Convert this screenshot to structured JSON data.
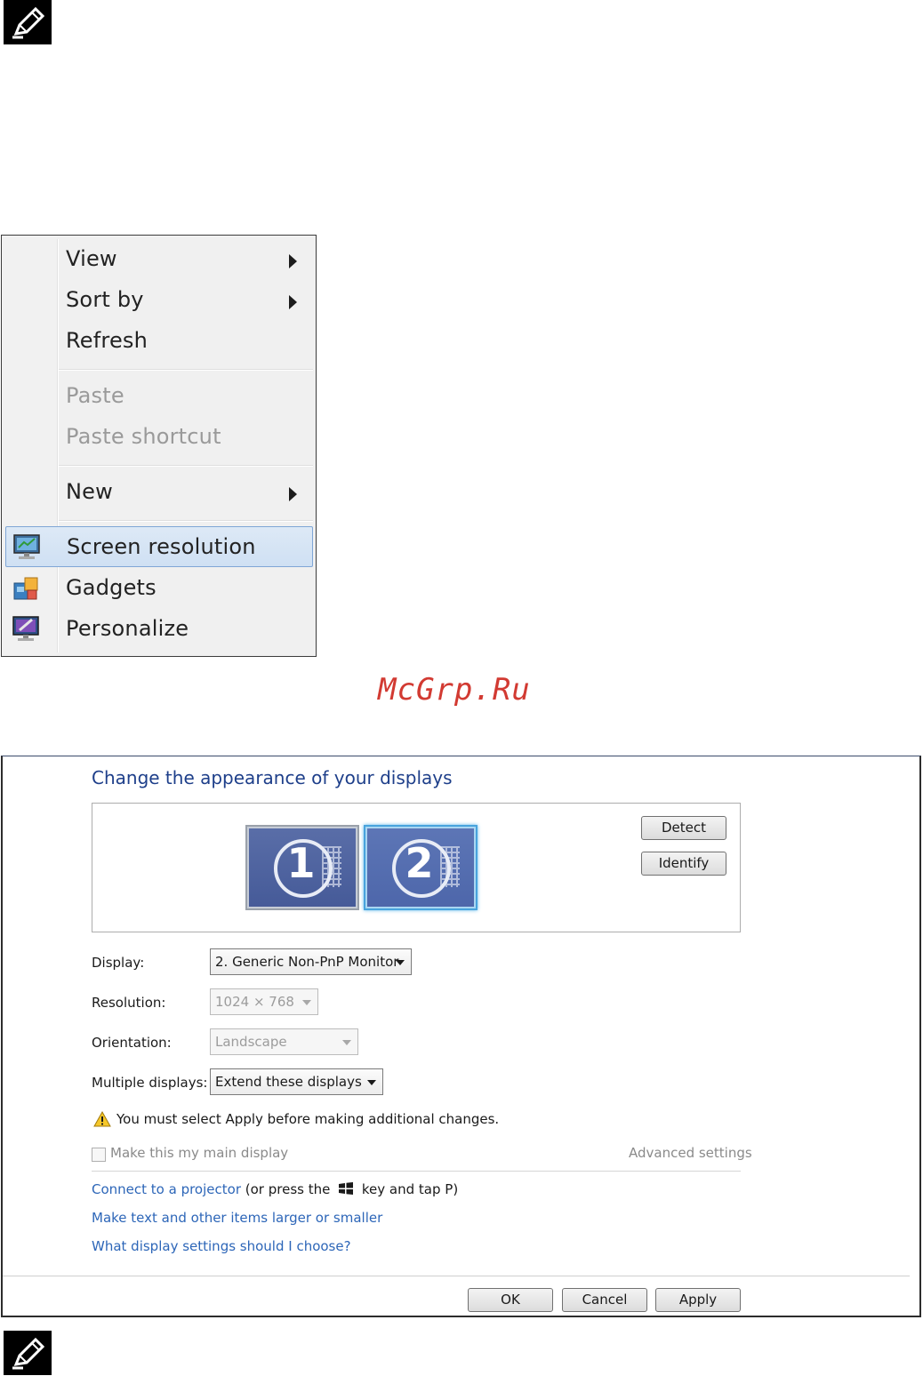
{
  "context_menu": {
    "items": [
      {
        "label": "View"
      },
      {
        "label": "Sort by"
      },
      {
        "label": "Refresh"
      },
      {
        "label": "Paste"
      },
      {
        "label": "Paste shortcut"
      },
      {
        "label": "New"
      },
      {
        "label": "Screen resolution"
      },
      {
        "label": "Gadgets"
      },
      {
        "label": "Personalize"
      }
    ]
  },
  "watermark": "McGrp.Ru",
  "dialog": {
    "title": "Change the appearance of your displays",
    "monitors": [
      "1",
      "2"
    ],
    "detect_label": "Detect",
    "identify_label": "Identify",
    "display_label": "Display:",
    "display_value": "2. Generic Non-PnP Monitor",
    "resolution_label": "Resolution:",
    "resolution_value": "1024 × 768",
    "orientation_label": "Orientation:",
    "orientation_value": "Landscape",
    "multiple_label": "Multiple displays:",
    "multiple_value": "Extend these displays",
    "warning": "You must select Apply before making additional changes.",
    "main_display_label": "Make this my main display",
    "advanced_label": "Advanced settings",
    "projector_link": "Connect to a projector",
    "projector_suffix_a": "(or press the",
    "projector_suffix_b": "key and tap P)",
    "text_size_link": "Make text and other items larger or smaller",
    "help_link": "What display settings should I choose?",
    "ok_label": "OK",
    "cancel_label": "Cancel",
    "apply_label": "Apply"
  },
  "colors": {
    "link": "#2d66b8",
    "title": "#1e3f8a",
    "selection": "#cfe0f3",
    "watermark": "#d23a32"
  }
}
